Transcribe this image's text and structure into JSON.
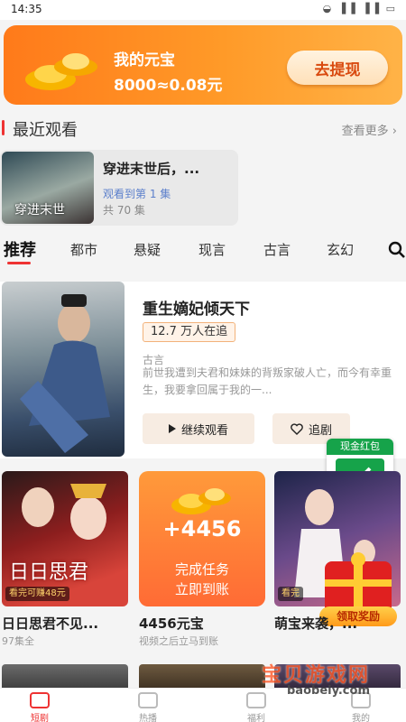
{
  "status_bar": {
    "time": "14:35",
    "icons": "◒ ▐▐ ▐▐ ▭"
  },
  "yuanbao": {
    "title": "我的元宝",
    "value": "8000≈0.08元",
    "withdraw_label": "去提现",
    "accent": "#ff7a1a"
  },
  "recent": {
    "title": "最近观看",
    "see_more": "查看更多 ›",
    "item": {
      "title": "穿进末世后，...",
      "progress": "观看到第 1 集",
      "total": "共 70 集",
      "cover_text": "穿进末世"
    }
  },
  "tabs": [
    {
      "label": "推荐",
      "active": true
    },
    {
      "label": "都市"
    },
    {
      "label": "悬疑"
    },
    {
      "label": "现言"
    },
    {
      "label": "古言"
    },
    {
      "label": "玄幻"
    }
  ],
  "featured": {
    "title": "重生嫡妃倾天下",
    "followers": "12.7 万人在追",
    "genre": "古言",
    "description": "前世我遭到夫君和妹妹的背叛家破人亡，而今有幸重生，我要拿回属于我的一...",
    "continue_label": "继续观看",
    "follow_label": "追剧"
  },
  "cash_widget": {
    "label": "现金红包"
  },
  "grid": [
    {
      "title": "日日思君不见...",
      "sub": "97集全",
      "cover_text": "日日思君",
      "earn_tag": "看完可赚48元"
    },
    {
      "title": "4456元宝",
      "sub": "视频之后立马到账",
      "amount": "+4456",
      "line1": "完成任务",
      "line2": "立即到账"
    },
    {
      "title": "萌宝来袭，...",
      "sub": "",
      "earn_tag": "看完"
    }
  ],
  "claim_label": "领取奖励",
  "bottom_nav": [
    {
      "label": "短剧",
      "active": true
    },
    {
      "label": "热播"
    },
    {
      "label": "福利"
    },
    {
      "label": "我的"
    }
  ],
  "watermark": {
    "title": "宝贝游戏网",
    "url": "baobeiy.com"
  }
}
